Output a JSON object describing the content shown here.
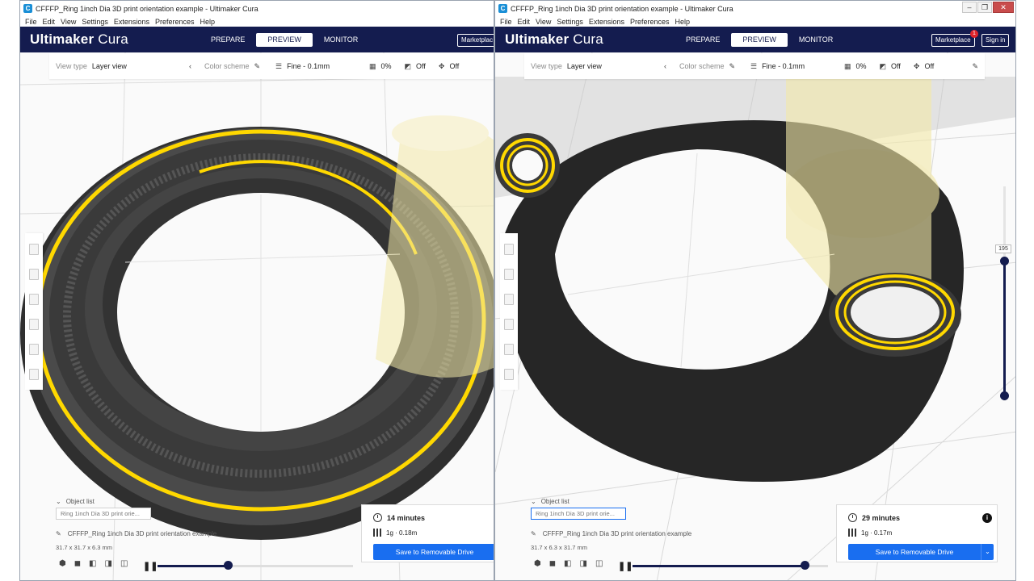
{
  "left_window": {
    "title": "CFFFP_Ring 1inch Dia 3D print orientation example - Ultimaker Cura",
    "menu": [
      "File",
      "Edit",
      "View",
      "Settings",
      "Extensions",
      "Preferences",
      "Help"
    ],
    "logo": {
      "brand": "Ultimaker",
      "product": "Cura"
    },
    "stages": [
      "PREPARE",
      "PREVIEW",
      "MONITOR"
    ],
    "active_stage": "PREVIEW",
    "marketplace_label": "Marketplac",
    "toolbar": {
      "view_type_label": "View type",
      "view_type_value": "Layer view",
      "color_scheme_label": "Color scheme",
      "profile": "Fine - 0.1mm",
      "infill": "0%",
      "support": "Off",
      "adhesion": "Off"
    },
    "object_list": {
      "header": "Object list",
      "item": "Ring 1inch Dia 3D print orie...",
      "file_name": "CFFFP_Ring 1inch Dia 3D print orientation example",
      "dimensions": "31.7 x 31.7 x 6.3 mm"
    },
    "print_info": {
      "time": "14 minutes",
      "material": "1g · 0.18m",
      "save_button": "Save to Removable Drive"
    },
    "simulation_progress": 0.36
  },
  "right_window": {
    "title": "CFFFP_Ring 1inch Dia 3D print orientation example - Ultimaker Cura",
    "menu": [
      "File",
      "Edit",
      "View",
      "Settings",
      "Extensions",
      "Preferences",
      "Help"
    ],
    "logo": {
      "brand": "Ultimaker",
      "product": "Cura"
    },
    "stages": [
      "PREPARE",
      "PREVIEW",
      "MONITOR"
    ],
    "active_stage": "PREVIEW",
    "marketplace_label": "Marketplace",
    "marketplace_badge": "1",
    "sign_in_label": "Sign in",
    "toolbar": {
      "view_type_label": "View type",
      "view_type_value": "Layer view",
      "color_scheme_label": "Color scheme",
      "profile": "Fine - 0.1mm",
      "infill": "0%",
      "support": "Off",
      "adhesion": "Off"
    },
    "object_list": {
      "header": "Object list",
      "item": "Ring 1inch Dia 3D print orie...",
      "file_name": "CFFFP_Ring 1inch Dia 3D print orientation example",
      "dimensions": "31.7 x 6.3 x 31.7 mm"
    },
    "print_info": {
      "time": "29 minutes",
      "material": "1g · 0.17m",
      "save_button": "Save to Removable Drive",
      "info_icon": "i"
    },
    "layer_number": "195",
    "simulation_progress": 0.88
  },
  "colors": {
    "header_bg": "#141c4f",
    "primary_blue": "#196ef0",
    "extrusion_yellow": "#ffd800",
    "model_dark": "#3c3c3c",
    "nozzle_ghost": "#f3e9a8"
  }
}
